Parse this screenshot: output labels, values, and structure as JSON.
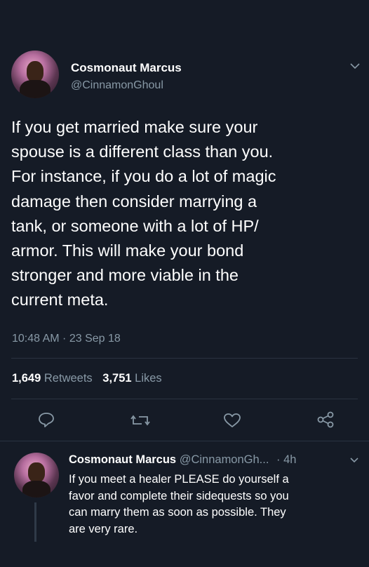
{
  "main_tweet": {
    "author_name": "Cosmonaut Marcus",
    "author_handle": "@CinnamonGhoul",
    "text_lines": [
      "If you get married make sure your",
      "spouse is a different class than you.",
      "For instance, if you do a lot of magic",
      "damage then consider marrying a",
      "tank, or someone with a lot of HP/",
      "armor. This will make your bond",
      "stronger and more viable in the",
      "current meta."
    ],
    "timestamp": "10:48 AM · 23 Sep 18",
    "retweets_count": "1,649",
    "retweets_label": "Retweets",
    "likes_count": "3,751",
    "likes_label": "Likes"
  },
  "actions": {
    "reply_icon": "reply-icon",
    "retweet_icon": "retweet-icon",
    "like_icon": "heart-icon",
    "share_icon": "share-icon"
  },
  "reply_tweet": {
    "author_name": "Cosmonaut Marcus",
    "author_handle": "@CinnamonGh...",
    "time": "· 4h",
    "text_lines": [
      "If you meet a healer PLEASE do yourself a",
      "favor and complete their sidequests so you",
      "can marry them as soon as possible. They",
      "are very rare."
    ]
  },
  "colors": {
    "background": "#151b26",
    "text": "#ffffff",
    "secondary_text": "#8899a6",
    "divider": "#2a3341"
  }
}
